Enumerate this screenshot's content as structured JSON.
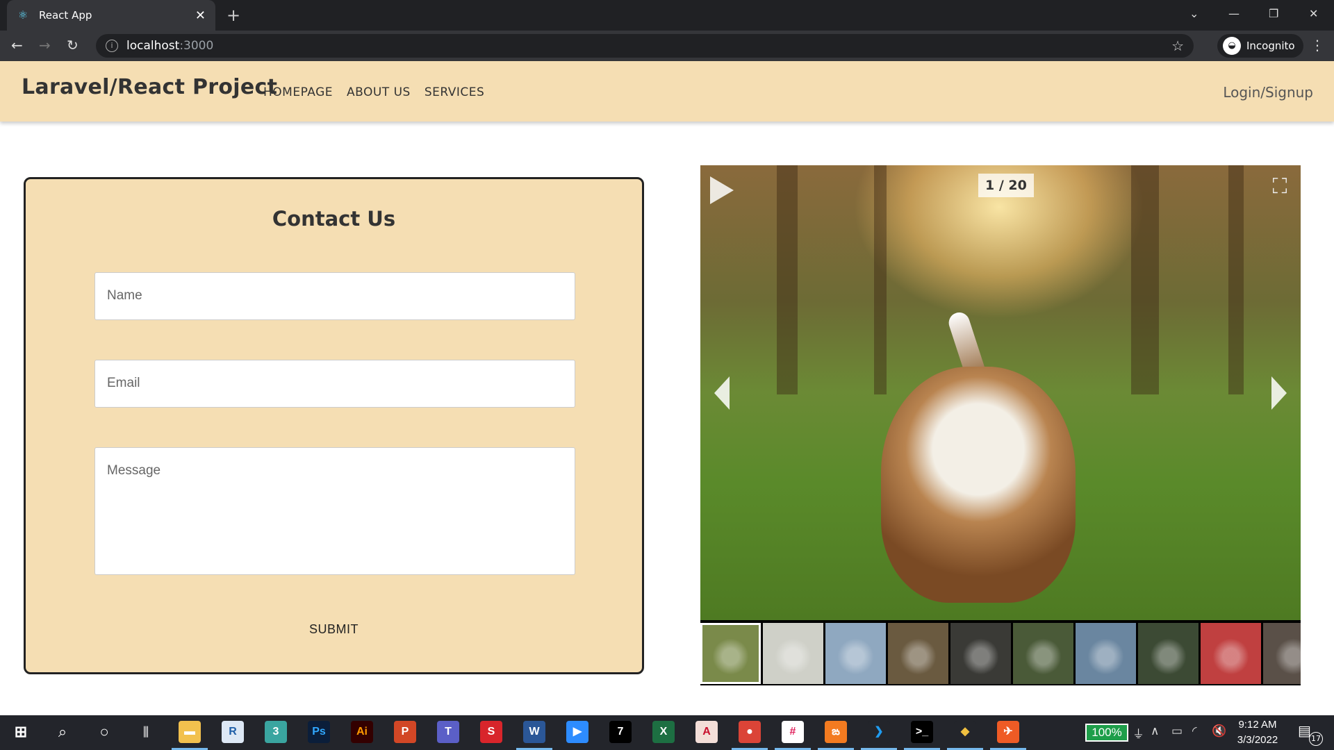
{
  "browser": {
    "tab_title": "React App",
    "tab_icon": "react-logo-icon",
    "url_host": "localhost",
    "url_port": ":3000",
    "profile_label": "Incognito"
  },
  "navbar": {
    "brand": "Laravel/React Project",
    "links": [
      {
        "label": "HOMEPAGE"
      },
      {
        "label": "ABOUT US"
      },
      {
        "label": "SERVICES"
      }
    ],
    "login": "Login/Signup",
    "background": "#f5deb3"
  },
  "contact": {
    "title": "Contact Us",
    "name_placeholder": "Name",
    "email_placeholder": "Email",
    "message_placeholder": "Message",
    "submit_label": "SUBMIT"
  },
  "gallery": {
    "counter": "1 / 20",
    "current_index": 1,
    "total": 20,
    "thumbnails": [
      {
        "color": "#7a8a4a"
      },
      {
        "color": "#cfd0c8"
      },
      {
        "color": "#8fa8c0"
      },
      {
        "color": "#6a5a40"
      },
      {
        "color": "#3a3a36"
      },
      {
        "color": "#4a5a38"
      },
      {
        "color": "#6a86a0"
      },
      {
        "color": "#3c4a34"
      },
      {
        "color": "#c04040"
      },
      {
        "color": "#5a5048"
      }
    ]
  },
  "taskbar": {
    "apps": [
      {
        "name": "file-explorer",
        "glyph": "▬",
        "color": "#f2c14e",
        "running": true
      },
      {
        "name": "revit",
        "glyph": "R",
        "color": "#dde8f5",
        "fg": "#1f5fa8",
        "running": false
      },
      {
        "name": "3ds-max",
        "glyph": "3",
        "color": "#3aa5a0",
        "running": false
      },
      {
        "name": "photoshop",
        "glyph": "Ps",
        "color": "#0b1e3a",
        "fg": "#31a8ff",
        "running": false
      },
      {
        "name": "illustrator",
        "glyph": "Ai",
        "color": "#330000",
        "fg": "#ff9a00",
        "running": false
      },
      {
        "name": "powerpoint",
        "glyph": "P",
        "color": "#d24726",
        "running": false
      },
      {
        "name": "teams",
        "glyph": "T",
        "color": "#5b5fc7",
        "running": false
      },
      {
        "name": "sketchup",
        "glyph": "S",
        "color": "#d8252b",
        "running": false
      },
      {
        "name": "word",
        "glyph": "W",
        "color": "#2b5797",
        "running": true
      },
      {
        "name": "zoom",
        "glyph": "▶",
        "color": "#2d8cff",
        "running": false
      },
      {
        "name": "rhino",
        "glyph": "7",
        "color": "#000000",
        "running": false
      },
      {
        "name": "excel",
        "glyph": "X",
        "color": "#1d6f42",
        "running": false
      },
      {
        "name": "autocad",
        "glyph": "A",
        "color": "#f3ded8",
        "fg": "#c8102e",
        "running": false
      },
      {
        "name": "chrome",
        "glyph": "●",
        "color": "#db4437",
        "running": true
      },
      {
        "name": "slack",
        "glyph": "#",
        "color": "#ffffff",
        "fg": "#e01e5a",
        "running": true
      },
      {
        "name": "xampp",
        "glyph": "ఙ",
        "color": "#f37b20",
        "running": true
      },
      {
        "name": "vscode",
        "glyph": "❯",
        "color": "#23252b",
        "fg": "#1f9cf0",
        "running": true
      },
      {
        "name": "terminal",
        "glyph": ">_",
        "color": "#000000",
        "running": true
      },
      {
        "name": "git-gui",
        "glyph": "◆",
        "color": "#23252b",
        "fg": "#f0c040",
        "running": true
      },
      {
        "name": "postman",
        "glyph": "✈",
        "color": "#ef5b25",
        "running": true
      }
    ],
    "battery": "100%",
    "time": "9:12 AM",
    "date": "3/3/2022",
    "notifications": "17"
  }
}
